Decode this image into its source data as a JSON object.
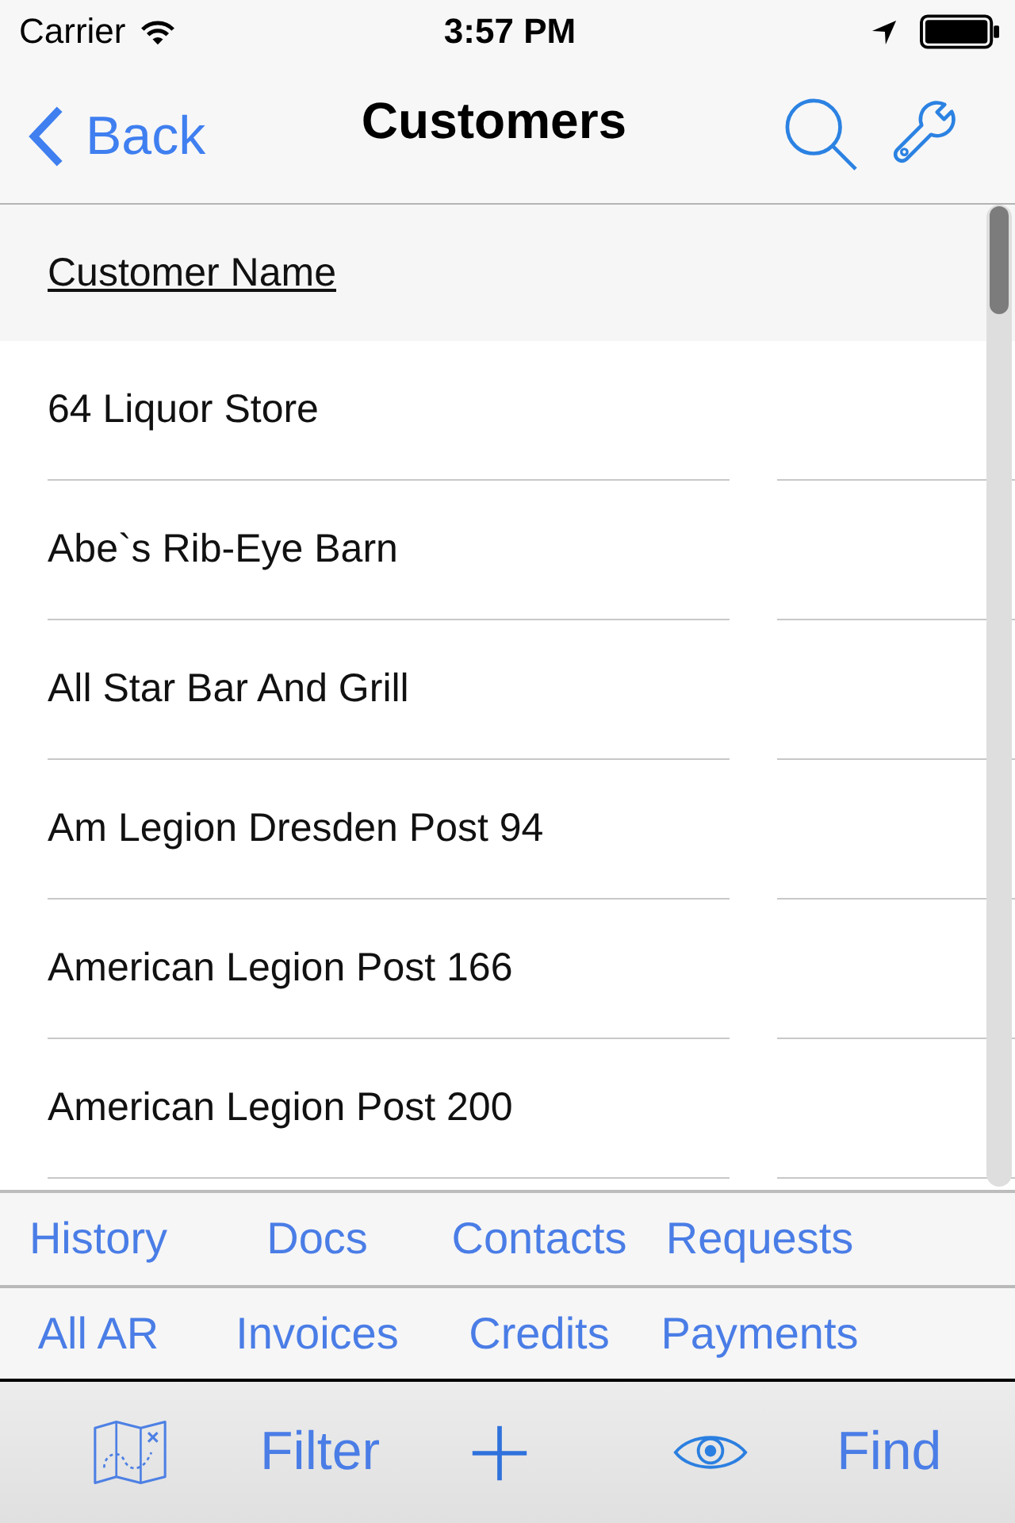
{
  "status_bar": {
    "carrier": "Carrier",
    "time": "3:57 PM"
  },
  "nav_bar": {
    "back": "Back",
    "title": "Customers"
  },
  "table": {
    "columns": [
      "Customer Name"
    ],
    "rows": [
      [
        "64 Liquor Store"
      ],
      [
        "Abe`s Rib-Eye Barn"
      ],
      [
        "All Star Bar And Grill"
      ],
      [
        "Am Legion Dresden Post 94"
      ],
      [
        "American Legion Post 166"
      ],
      [
        "American Legion Post 200"
      ]
    ]
  },
  "section_tabs": [
    [
      "History",
      "Docs",
      "Contacts",
      "Requests"
    ],
    [
      "All AR",
      "Invoices",
      "Credits",
      "Payments"
    ]
  ],
  "toolbar": {
    "filter": "Filter",
    "find": "Find"
  }
}
